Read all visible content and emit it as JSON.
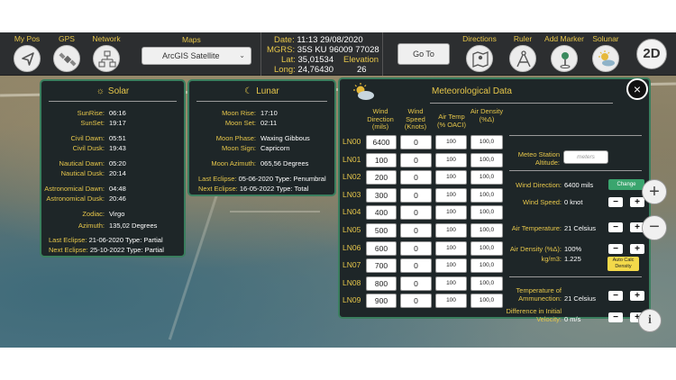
{
  "toolbar": {
    "my_pos": "My Pos",
    "gps": "GPS",
    "network": "Network",
    "maps_label": "Maps",
    "maps_selected": "ArcGIS Satellite",
    "date_label": "Date:",
    "date_value": "11:13  29/08/2020",
    "mgrs_label": "MGRS:",
    "mgrs_value": "35S KU 96009 77028",
    "lat_label": "Lat:",
    "lat_value": "35,01534",
    "long_label": "Long:",
    "long_value": "24,76430",
    "elevation_label": "Elevation",
    "elevation_value": "26",
    "goto": "Go To",
    "directions": "Directions",
    "ruler": "Ruler",
    "add_marker": "Add Marker",
    "solunar": "Solunar",
    "mode_2d": "2D"
  },
  "solar": {
    "title": "Solar",
    "sunrise_k": "SunRise:",
    "sunrise_v": "06:16",
    "sunset_k": "SunSet:",
    "sunset_v": "19:17",
    "civil_dawn_k": "Civil Dawn:",
    "civil_dawn_v": "05:51",
    "civil_dusk_k": "Civil Dusk:",
    "civil_dusk_v": "19:43",
    "naut_dawn_k": "Nautical Dawn:",
    "naut_dawn_v": "05:20",
    "naut_dusk_k": "Nautical Dusk:",
    "naut_dusk_v": "20:14",
    "astro_dawn_k": "Astronomical Dawn:",
    "astro_dawn_v": "04:48",
    "astro_dusk_k": "Astronomical Dusk:",
    "astro_dusk_v": "20:46",
    "zodiac_k": "Zodiac:",
    "zodiac_v": "Virgo",
    "azimuth_k": "Azimuth:",
    "azimuth_v": "135,02 Degrees",
    "last_eclipse_k": "Last Eclipse:",
    "last_eclipse_v": "21-06-2020 Type: Partial",
    "next_eclipse_k": "Next Eclipse:",
    "next_eclipse_v": "25-10-2022 Type: Partial"
  },
  "lunar": {
    "title": "Lunar",
    "moonrise_k": "Moon Rise:",
    "moonrise_v": "17:10",
    "moonset_k": "Moon Set:",
    "moonset_v": "02:11",
    "phase_k": "Moon Phase:",
    "phase_v": "Waxing Gibbous",
    "sign_k": "Moon Sign:",
    "sign_v": "Capricorn",
    "azimuth_k": "Moon Azimuth:",
    "azimuth_v": "065,56 Degrees",
    "last_eclipse_k": "Last Eclipse:",
    "last_eclipse_v": "05-06-2020 Type: Penumbral",
    "next_eclipse_k": "Next Eclipse:",
    "next_eclipse_v": "16-05-2022 Type: Total"
  },
  "meteo": {
    "title": "Meteorological Data",
    "col_dir": "Wind Direction (mils)",
    "col_spd": "Wind Speed (Knots)",
    "col_tmp": "Air Temp (% OACI)",
    "col_den": "Air Density (%Δ)",
    "rows": [
      {
        "ln": "LN00",
        "dir": "6400",
        "spd": "0",
        "tmp": "100",
        "den": "100,0"
      },
      {
        "ln": "LN01",
        "dir": "100",
        "spd": "0",
        "tmp": "100",
        "den": "100,0"
      },
      {
        "ln": "LN02",
        "dir": "200",
        "spd": "0",
        "tmp": "100",
        "den": "100,0"
      },
      {
        "ln": "LN03",
        "dir": "300",
        "spd": "0",
        "tmp": "100",
        "den": "100,0"
      },
      {
        "ln": "LN04",
        "dir": "400",
        "spd": "0",
        "tmp": "100",
        "den": "100,0"
      },
      {
        "ln": "LN05",
        "dir": "500",
        "spd": "0",
        "tmp": "100",
        "den": "100,0"
      },
      {
        "ln": "LN06",
        "dir": "600",
        "spd": "0",
        "tmp": "100",
        "den": "100,0"
      },
      {
        "ln": "LN07",
        "dir": "700",
        "spd": "0",
        "tmp": "100",
        "den": "100,0"
      },
      {
        "ln": "LN08",
        "dir": "800",
        "spd": "0",
        "tmp": "100",
        "den": "100,0"
      },
      {
        "ln": "LN09",
        "dir": "900",
        "spd": "0",
        "tmp": "100",
        "den": "100,0"
      }
    ],
    "station_alt_label": "Meteo Station Altitude:",
    "station_alt_placeholder": "meters",
    "wind_dir_k": "Wind Direction:",
    "wind_dir_v": "6400 mils",
    "change": "Change",
    "wind_speed_k": "Wind Speed:",
    "wind_speed_v": "0 knot",
    "air_temp_k": "Air Temperature:",
    "air_temp_v": "21 Celsius",
    "air_density_k": "Air Density (%Δ):",
    "air_density_v": "100%",
    "kgm3_k": "kg/m3:",
    "kgm3_v": "1.225",
    "auto_calc": "Auto Calc Density",
    "ammo_temp_k": "Temperature of Ammunection:",
    "ammo_temp_v": "21 Celsius",
    "diff_vel_k": "Difference in Initial Velocity:",
    "diff_vel_v": "0 m/s",
    "plus": "+",
    "minus": "−"
  },
  "icons": {
    "close": "×",
    "info": "i",
    "zoom_in": "+",
    "zoom_out": "−"
  }
}
